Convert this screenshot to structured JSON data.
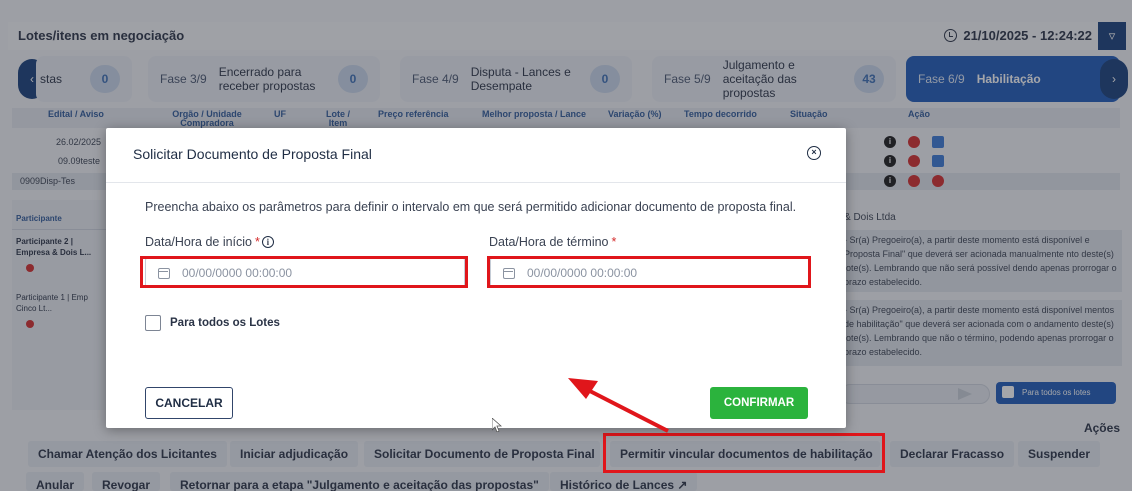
{
  "header": {
    "title": "Lotes/itens em negociação",
    "datetime": "21/10/2025 - 12:24:22"
  },
  "phases": [
    {
      "label": "stas",
      "count": "0"
    },
    {
      "num": "Fase 3/9",
      "label": "Encerrado para receber propostas",
      "count": "0"
    },
    {
      "num": "Fase 4/9",
      "label": "Disputa - Lances e Desempate",
      "count": "0"
    },
    {
      "num": "Fase 5/9",
      "label": "Julgamento e aceitação das propostas",
      "count": "43"
    },
    {
      "num": "Fase 6/9",
      "label": "Habilitação"
    }
  ],
  "table": {
    "headers": [
      "Edital / Aviso",
      "Orgão / Unidade Compradora",
      "UF",
      "Lote / Item",
      "Preço referência",
      "Melhor proposta / Lance",
      "Variação (%)",
      "Tempo decorrido",
      "Situação",
      "Ação"
    ],
    "rows": [
      {
        "edital": "26.02/2025"
      },
      {
        "edital": "09.09teste"
      },
      {
        "edital": "0909Disp-Tes"
      }
    ]
  },
  "left_panel": {
    "header": "Participante",
    "items": [
      "Participante 2 | Empresa & Dois L...",
      "Participante 1 | Emp Cinco Lt..."
    ]
  },
  "right_panel": {
    "title": "& Dois Ltda",
    "messages": [
      "- Sr(a) Pregoeiro(a), a partir deste momento está disponível e Proposta Final\" que deverá ser acionada manualmente nto deste(s) lote(s). Lembrando que não será possível dendo apenas prorrogar o prazo estabelecido.",
      "- Sr(a) Pregoeiro(a), a partir deste momento está disponível mentos de habilitação\" que deverá ser acionada com o andamento deste(s) lote(s). Lembrando que não o término, podendo apenas prorrogar o prazo estabelecido."
    ],
    "checkbox_label": "Para todos os lotes"
  },
  "actions": {
    "label": "Ações",
    "row1": [
      "Chamar Atenção dos Licitantes",
      "Iniciar adjudicação",
      "Solicitar Documento de Proposta Final",
      "Permitir vincular documentos de habilitação",
      "Declarar Fracasso",
      "Suspender"
    ],
    "row2": [
      "Anular",
      "Revogar",
      "Retornar para a etapa \"Julgamento e aceitação das propostas\"",
      "Histórico de Lances"
    ]
  },
  "modal": {
    "title": "Solicitar Documento de Proposta Final",
    "description": "Preencha abaixo os parâmetros para definir o intervalo em que será permitido adicionar documento de proposta final.",
    "start_label": "Data/Hora de início",
    "end_label": "Data/Hora de término",
    "required_mark": "*",
    "start_placeholder": "00/00/0000 00:00:00",
    "end_placeholder": "00/00/0000 00:00:00",
    "all_lots_label": "Para todos os Lotes",
    "cancel_label": "CANCELAR",
    "confirm_label": "CONFIRMAR"
  },
  "colors": {
    "primary": "#1e5bb8",
    "confirm": "#2bb33d",
    "highlight": "#e0161b",
    "status_red": "#d42b2b"
  }
}
